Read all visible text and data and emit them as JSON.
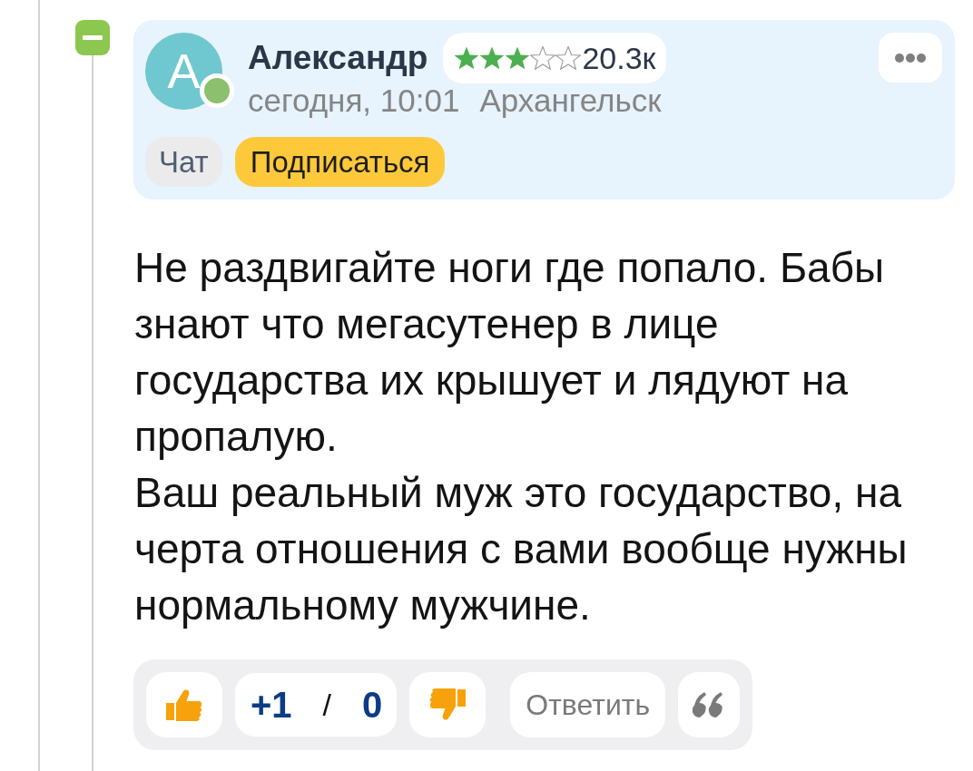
{
  "thread": {
    "expanded": true
  },
  "author": {
    "avatar_letter": "А",
    "online": true,
    "name": "Александр",
    "stars": 3,
    "rating": "20.3к",
    "date": "сегодня, 10:01",
    "city": "Архангельск"
  },
  "header_buttons": [
    {
      "label": "Чат",
      "kind": "chat"
    },
    {
      "label": "Подписаться",
      "kind": "subscribe"
    }
  ],
  "comment": {
    "paragraphs": [
      "Не раздвигайте ноги где попало. Бабы знают что мегасутенер в лице государства их крышует и лядуют на пропалую.",
      "Ваш реальный муж это государство, на черта отношения с вами вообще нужны нормальному мужчине."
    ]
  },
  "actions": {
    "votes": {
      "up": "+1",
      "separator": "/",
      "down": "0"
    },
    "reply": "Ответить"
  }
}
